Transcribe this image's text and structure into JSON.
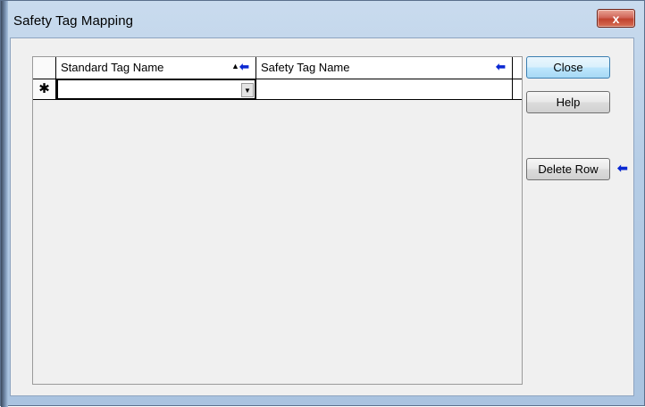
{
  "window": {
    "title": "Safety Tag Mapping",
    "close_glyph": "x"
  },
  "grid": {
    "columns": [
      {
        "label": "Standard Tag Name",
        "sort_glyph": "▲",
        "arrow_glyph": "⬅"
      },
      {
        "label": "Safety Tag Name",
        "arrow_glyph": "⬅"
      }
    ],
    "new_row_marker": "✱",
    "rows": [
      {
        "standard_tag": "",
        "safety_tag": ""
      }
    ],
    "combo_glyph": "▼"
  },
  "buttons": {
    "close_label": "Close",
    "help_label": "Help",
    "delete_row_label": "Delete Row",
    "delete_arrow_glyph": "⬅"
  },
  "colors": {
    "accent_arrow": "#0a28d2",
    "titlebar": "#b6cde6",
    "close_button": "#c1432f"
  }
}
